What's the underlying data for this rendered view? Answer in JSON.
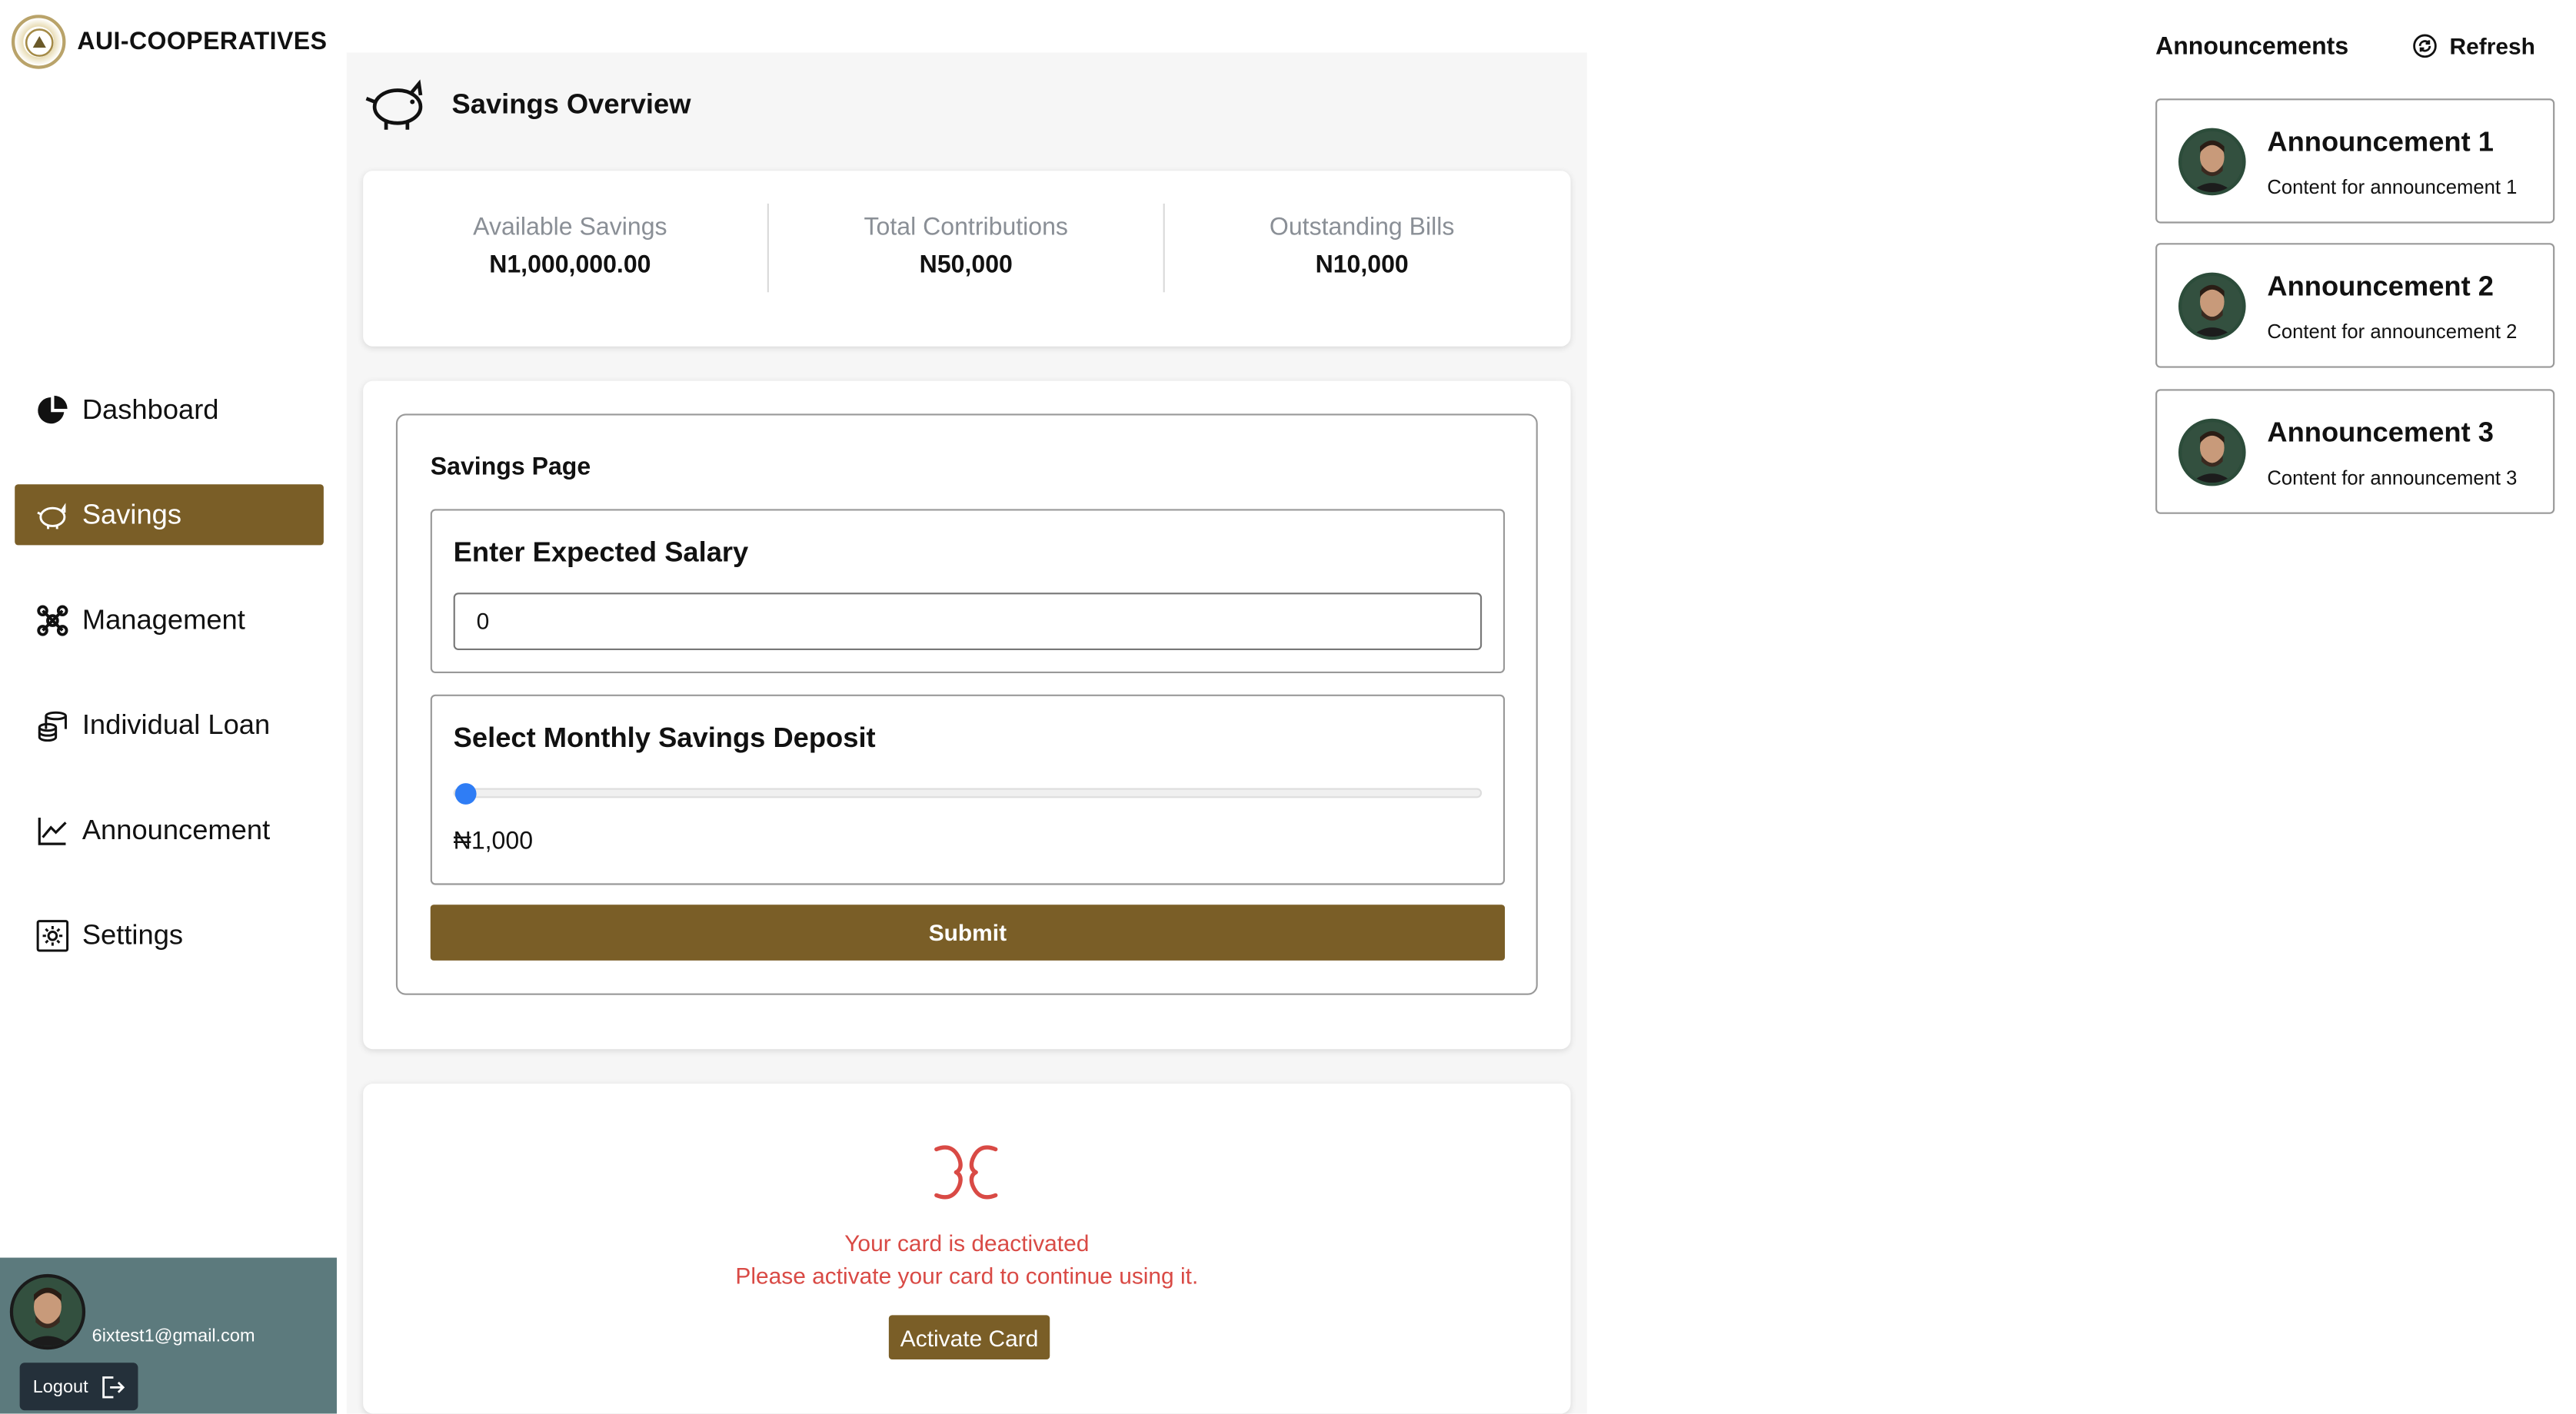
{
  "brand": {
    "name": "AUI-COOPERATIVES"
  },
  "sidebar": {
    "items": [
      {
        "label": "Dashboard",
        "icon": "pie-chart-icon",
        "active": false
      },
      {
        "label": "Savings",
        "icon": "piggy-bank-icon",
        "active": true
      },
      {
        "label": "Management",
        "icon": "management-icon",
        "active": false
      },
      {
        "label": "Individual Loan",
        "icon": "coins-stack-icon",
        "active": false
      },
      {
        "label": "Announcement",
        "icon": "line-chart-icon",
        "active": false
      },
      {
        "label": "Settings",
        "icon": "gear-icon",
        "active": false
      }
    ],
    "user": {
      "email": "6ixtest1@gmail.com",
      "logout_label": "Logout"
    }
  },
  "main": {
    "title": "Savings Overview",
    "stats": [
      {
        "label": "Available Savings",
        "value": "N1,000,000.00"
      },
      {
        "label": "Total Contributions",
        "value": "N50,000"
      },
      {
        "label": "Outstanding Bills",
        "value": "N10,000"
      }
    ],
    "form": {
      "title": "Savings Page",
      "salary_label": "Enter Expected Salary",
      "salary_value": "0",
      "deposit_label": "Select Monthly Savings Deposit",
      "deposit_value": "₦1,000",
      "deposit_fraction": 0.0,
      "submit_label": "Submit"
    },
    "card_warning": {
      "line1": "Your card is deactivated",
      "line2": "Please activate your card to continue using it.",
      "button_label": "Activate Card"
    }
  },
  "announcements": {
    "heading": "Announcements",
    "refresh_label": "Refresh",
    "items": [
      {
        "title": "Announcement 1",
        "content": "Content for announcement 1"
      },
      {
        "title": "Announcement 2",
        "content": "Content for announcement 2"
      },
      {
        "title": "Announcement 3",
        "content": "Content for announcement 3"
      }
    ]
  },
  "colors": {
    "brand": "#7a5e27",
    "sidebar_user_bg": "#5c7a7d",
    "warning": "#d94a45",
    "slider": "#2f7df5"
  }
}
